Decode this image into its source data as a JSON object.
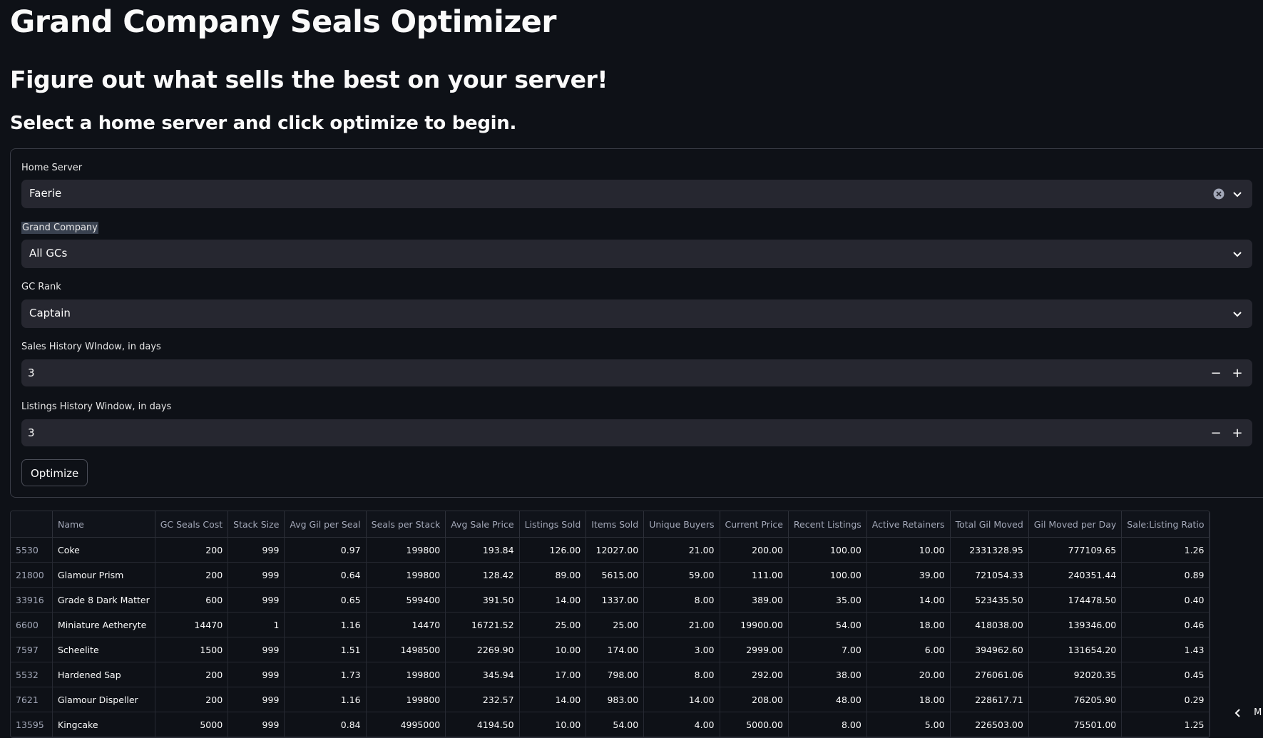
{
  "title": "Grand Company Seals Optimizer",
  "subtitle": "Figure out what sells the best on your server!",
  "instruction": "Select a home server and click optimize to begin.",
  "form": {
    "home_server": {
      "label": "Home Server",
      "value": "Faerie"
    },
    "grand_company": {
      "label": "Grand Company",
      "value": "All GCs"
    },
    "gc_rank": {
      "label": "GC Rank",
      "value": "Captain"
    },
    "sales_window": {
      "label": "Sales History WIndow, in days",
      "value": "3"
    },
    "listings_window": {
      "label": "Listings History Window, in days",
      "value": "3"
    },
    "optimize_label": "Optimize"
  },
  "table": {
    "columns": [
      "",
      "Name",
      "GC Seals Cost",
      "Stack Size",
      "Avg Gil per Seal",
      "Seals per Stack",
      "Avg Sale Price",
      "Listings Sold",
      "Items Sold",
      "Unique Buyers",
      "Current Price",
      "Recent Listings",
      "Active Retainers",
      "Total Gil Moved",
      "Gil Moved per Day",
      "Sale:Listing Ratio"
    ],
    "rows": [
      [
        "5530",
        "Coke",
        "200",
        "999",
        "0.97",
        "199800",
        "193.84",
        "126.00",
        "12027.00",
        "21.00",
        "200.00",
        "100.00",
        "10.00",
        "2331328.95",
        "777109.65",
        "1.26"
      ],
      [
        "21800",
        "Glamour Prism",
        "200",
        "999",
        "0.64",
        "199800",
        "128.42",
        "89.00",
        "5615.00",
        "59.00",
        "111.00",
        "100.00",
        "39.00",
        "721054.33",
        "240351.44",
        "0.89"
      ],
      [
        "33916",
        "Grade 8 Dark Matter",
        "600",
        "999",
        "0.65",
        "599400",
        "391.50",
        "14.00",
        "1337.00",
        "8.00",
        "389.00",
        "35.00",
        "14.00",
        "523435.50",
        "174478.50",
        "0.40"
      ],
      [
        "6600",
        "Miniature Aetheryte",
        "14470",
        "1",
        "1.16",
        "14470",
        "16721.52",
        "25.00",
        "25.00",
        "21.00",
        "19900.00",
        "54.00",
        "18.00",
        "418038.00",
        "139346.00",
        "0.46"
      ],
      [
        "7597",
        "Scheelite",
        "1500",
        "999",
        "1.51",
        "1498500",
        "2269.90",
        "10.00",
        "174.00",
        "3.00",
        "2999.00",
        "7.00",
        "6.00",
        "394962.60",
        "131654.20",
        "1.43"
      ],
      [
        "5532",
        "Hardened Sap",
        "200",
        "999",
        "1.73",
        "199800",
        "345.94",
        "17.00",
        "798.00",
        "8.00",
        "292.00",
        "38.00",
        "20.00",
        "276061.06",
        "92020.35",
        "0.45"
      ],
      [
        "7621",
        "Glamour Dispeller",
        "200",
        "999",
        "1.16",
        "199800",
        "232.57",
        "14.00",
        "983.00",
        "14.00",
        "208.00",
        "48.00",
        "18.00",
        "228617.71",
        "76205.90",
        "0.29"
      ],
      [
        "13595",
        "Kingcake",
        "5000",
        "999",
        "0.84",
        "4995000",
        "4194.50",
        "10.00",
        "54.00",
        "4.00",
        "5000.00",
        "8.00",
        "5.00",
        "226503.00",
        "75501.00",
        "1.25"
      ]
    ]
  },
  "corner_text": "M"
}
